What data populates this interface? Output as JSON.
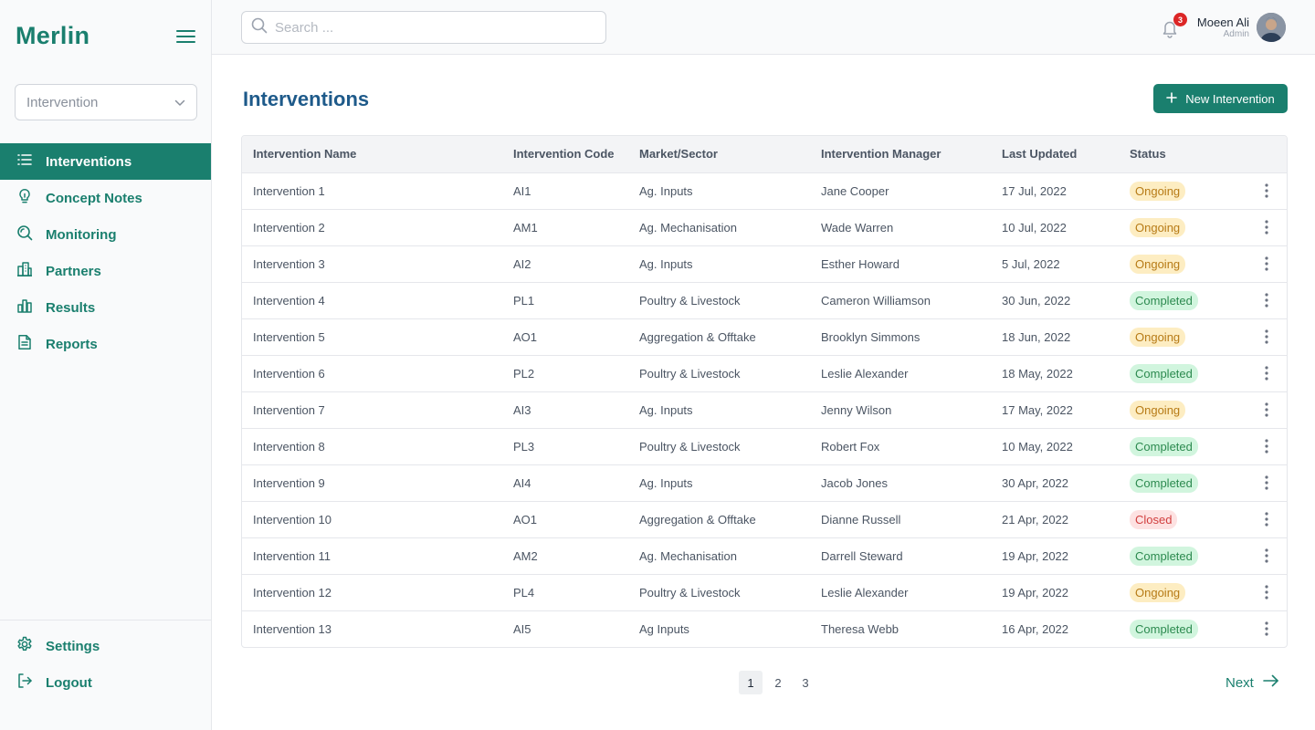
{
  "app": {
    "logo": "Merlin"
  },
  "sidebar": {
    "selector": {
      "value": "Intervention",
      "icon": "chevron-down-icon"
    },
    "items": [
      {
        "label": "Interventions",
        "icon": "list-icon",
        "active": true
      },
      {
        "label": "Concept Notes",
        "icon": "lightbulb-icon",
        "active": false
      },
      {
        "label": "Monitoring",
        "icon": "magnifier-icon",
        "active": false
      },
      {
        "label": "Partners",
        "icon": "building-icon",
        "active": false
      },
      {
        "label": "Results",
        "icon": "bar-chart-icon",
        "active": false
      },
      {
        "label": "Reports",
        "icon": "document-icon",
        "active": false
      }
    ],
    "bottom_items": [
      {
        "label": "Settings",
        "icon": "gear-icon"
      },
      {
        "label": "Logout",
        "icon": "logout-icon"
      }
    ]
  },
  "header": {
    "search_placeholder": "Search ...",
    "notification_count": "3",
    "user": {
      "name": "Moeen Ali",
      "role": "Admin"
    }
  },
  "main": {
    "title": "Interventions",
    "new_button_label": "New Intervention",
    "table": {
      "columns": [
        "Intervention Name",
        "Intervention Code",
        "Market/Sector",
        "Intervention Manager",
        "Last Updated",
        "Status"
      ],
      "rows": [
        {
          "name": "Intervention 1",
          "code": "AI1",
          "sector": "Ag. Inputs",
          "manager": "Jane Cooper",
          "updated": "17 Jul, 2022",
          "status": "Ongoing"
        },
        {
          "name": "Intervention 2",
          "code": "AM1",
          "sector": "Ag. Mechanisation",
          "manager": "Wade Warren",
          "updated": "10 Jul, 2022",
          "status": "Ongoing"
        },
        {
          "name": "Intervention 3",
          "code": "AI2",
          "sector": "Ag. Inputs",
          "manager": "Esther Howard",
          "updated": "5 Jul, 2022",
          "status": "Ongoing"
        },
        {
          "name": "Intervention 4",
          "code": "PL1",
          "sector": "Poultry & Livestock",
          "manager": "Cameron Williamson",
          "updated": "30 Jun, 2022",
          "status": "Completed"
        },
        {
          "name": "Intervention 5",
          "code": "AO1",
          "sector": "Aggregation & Offtake",
          "manager": "Brooklyn Simmons",
          "updated": "18 Jun, 2022",
          "status": "Ongoing"
        },
        {
          "name": "Intervention 6",
          "code": "PL2",
          "sector": "Poultry & Livestock",
          "manager": "Leslie Alexander",
          "updated": "18 May, 2022",
          "status": "Completed"
        },
        {
          "name": "Intervention 7",
          "code": "AI3",
          "sector": "Ag. Inputs",
          "manager": "Jenny Wilson",
          "updated": "17 May, 2022",
          "status": "Ongoing"
        },
        {
          "name": "Intervention 8",
          "code": "PL3",
          "sector": "Poultry & Livestock",
          "manager": "Robert Fox",
          "updated": "10 May, 2022",
          "status": "Completed"
        },
        {
          "name": "Intervention 9",
          "code": "AI4",
          "sector": "Ag. Inputs",
          "manager": "Jacob Jones",
          "updated": "30 Apr, 2022",
          "status": "Completed"
        },
        {
          "name": "Intervention 10",
          "code": "AO1",
          "sector": "Aggregation & Offtake",
          "manager": "Dianne Russell",
          "updated": "21 Apr, 2022",
          "status": "Closed"
        },
        {
          "name": "Intervention 11",
          "code": "AM2",
          "sector": "Ag. Mechanisation",
          "manager": "Darrell Steward",
          "updated": "19 Apr, 2022",
          "status": "Completed"
        },
        {
          "name": "Intervention 12",
          "code": "PL4",
          "sector": "Poultry & Livestock",
          "manager": "Leslie Alexander",
          "updated": "19 Apr, 2022",
          "status": "Ongoing"
        },
        {
          "name": "Intervention 13",
          "code": "AI5",
          "sector": "Ag Inputs",
          "manager": "Theresa Webb",
          "updated": "16 Apr, 2022",
          "status": "Completed"
        }
      ]
    },
    "pagination": {
      "pages": [
        "1",
        "2",
        "3"
      ],
      "current": "1",
      "next_label": "Next"
    }
  },
  "colors": {
    "brand": "#1a7f6e",
    "title": "#1e5a8a",
    "ongoing": "#b77b16",
    "completed": "#2c8a4f",
    "closed": "#d13e3e"
  }
}
